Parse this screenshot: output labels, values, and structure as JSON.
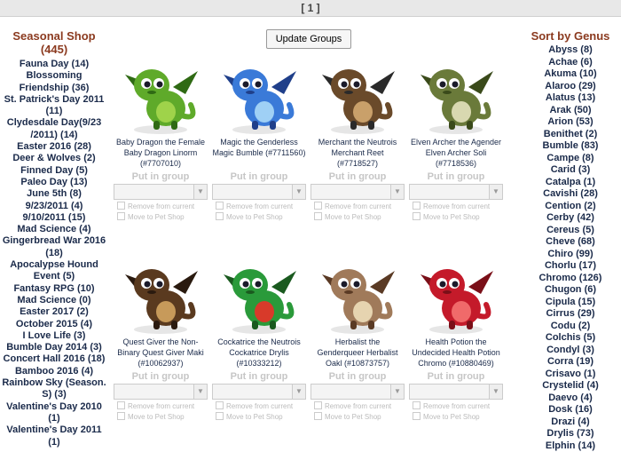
{
  "pagination": {
    "label": "[ 1 ]"
  },
  "update_button": {
    "label": "Update Groups"
  },
  "seasonal_shop": {
    "title": "Seasonal Shop",
    "count": "(445)",
    "items": [
      "Fauna Day (14)",
      "Blossoming Friendship (36)",
      "St. Patrick's Day 2011 (11)",
      "Clydesdale Day(9/23 /2011) (14)",
      "Easter 2016 (28)",
      "Deer & Wolves (2)",
      "Finned Day (5)",
      "Paleo Day (13)",
      "June 5th (8)",
      "9/23/2011 (4)",
      "9/10/2011 (15)",
      "Mad Science (4)",
      "Gingerbread War 2016 (18)",
      "Apocalypse Hound Event (5)",
      "Fantasy RPG (10)",
      "Mad Science (0)",
      "Easter 2017 (2)",
      "October 2015 (4)",
      "I Love Life (3)",
      "Bumble Day 2014 (3)",
      "Concert Hall 2016 (18)",
      "Bamboo 2016 (4)",
      "Rainbow Sky (Season. S) (3)",
      "Valentine's Day 2010 (1)",
      "Valentine's Day 2011 (1)"
    ]
  },
  "sort_by_genus": {
    "title": "Sort by Genus",
    "items": [
      "Abyss (8)",
      "Achae (6)",
      "Akuma (10)",
      "Alaroo (29)",
      "Alatus (13)",
      "Arak (50)",
      "Arion (53)",
      "Benithet (2)",
      "Bumble (83)",
      "Campe (8)",
      "Carid (3)",
      "Catalpa (1)",
      "Cavishi (28)",
      "Cention (2)",
      "Cerby (42)",
      "Cereus (5)",
      "Cheve (68)",
      "Chiro (99)",
      "Chorlu (17)",
      "Chromo (126)",
      "Chugon (6)",
      "Cipula (15)",
      "Cirrus (29)",
      "Codu (2)",
      "Colchis (5)",
      "Condyl (3)",
      "Corra (19)",
      "Crisavo (1)",
      "Crystelid (4)",
      "Daevo (4)",
      "Dosk (16)",
      "Drazi (4)",
      "Drylis (73)",
      "Elphin (14)"
    ]
  },
  "pets": [
    {
      "name": "Baby Dragon the Female Baby Dragon Linorm (#7707010)",
      "icon": "green-dragon-icon",
      "colors": [
        "#5faa2a",
        "#9fd34a",
        "#2f6a14"
      ]
    },
    {
      "name": "Magic the Genderless Magic Bumble (#7711560)",
      "icon": "blue-bumble-icon",
      "colors": [
        "#3a7ad8",
        "#9fd0f5",
        "#1f3f8a"
      ]
    },
    {
      "name": "Merchant the Neutrois Merchant Reet (#7718527)",
      "icon": "merchant-reet-icon",
      "colors": [
        "#6a4a2a",
        "#c9a06a",
        "#2a2a2a"
      ]
    },
    {
      "name": "Elven Archer the Agender Elven Archer Soli (#7718536)",
      "icon": "elven-archer-icon",
      "colors": [
        "#6a7a3a",
        "#d8d8b0",
        "#3a4a1a"
      ]
    },
    {
      "name": "Quest Giver the Non-Binary Quest Giver Maki (#10062937)",
      "icon": "quest-giver-icon",
      "colors": [
        "#5a3a1f",
        "#c79a5a",
        "#2a1a0f"
      ]
    },
    {
      "name": "Cockatrice the Neutrois Cockatrice Drylis (#10333212)",
      "icon": "cockatrice-icon",
      "colors": [
        "#2a9a3a",
        "#d83a2a",
        "#1a5a1f"
      ]
    },
    {
      "name": "Herbalist the Genderqueer Herbalist Oakl (#10873757)",
      "icon": "herbalist-icon",
      "colors": [
        "#a07a5a",
        "#e6d4b0",
        "#5a3a24"
      ]
    },
    {
      "name": "Health Potion the Undecided Health Potion Chromo (#10880469)",
      "icon": "health-potion-icon",
      "colors": [
        "#c41a2a",
        "#f06a6a",
        "#7a0f18"
      ]
    }
  ],
  "card_controls": {
    "put_in_group": "Put in group",
    "remove_label": "Remove from current",
    "move_label": "Move to Pet Shop"
  }
}
